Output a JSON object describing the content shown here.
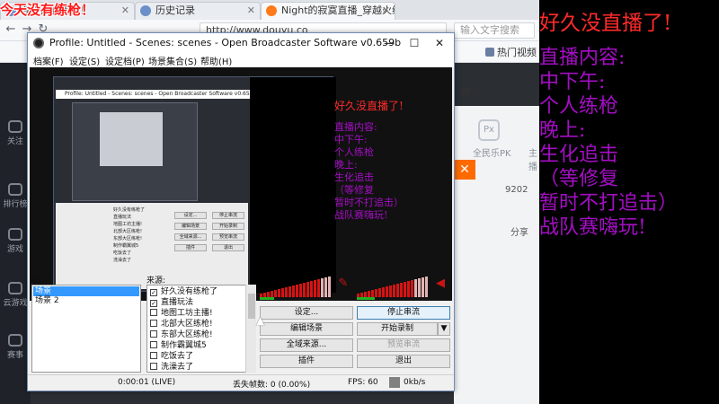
{
  "browser": {
    "tabs": [
      {
        "label": "今天没有练枪！",
        "active": false
      },
      {
        "label": "历史记录",
        "active": false
      },
      {
        "label": "Night的寂寞直播_穿越火线",
        "active": true
      }
    ],
    "url": "http://www.douyu.co",
    "search_hint": "输入文字搜索",
    "bookmarks": [
      {
        "label": "热门视频"
      }
    ],
    "douyu": {
      "sidebar": [
        "关注",
        "排行榜",
        "游戏",
        "云游戏",
        "赛事"
      ],
      "header_items": [
        "修",
        "Px"
      ],
      "pk_label": "全民乐PK",
      "view_count": "9202",
      "share": "分享",
      "side_label": "主播"
    }
  },
  "overlay": {
    "title": "好久没直播了!",
    "lines": [
      "直播内容:",
      "中下午:",
      "个人练枪",
      "晚上:",
      "生化追击",
      "（等修复",
      "暂时不打追击）",
      "战队赛嗨玩!"
    ]
  },
  "obs": {
    "title": "Profile: Untitled - Scenes: scenes - Open Broadcaster Software v0.659b",
    "window_controls": {
      "minimize": "—",
      "maximize": "☐",
      "close": "✕"
    },
    "menu": [
      "档案(F)",
      "设定(S)",
      "设定档(P)",
      "场景集合(S)",
      "帮助(H)"
    ],
    "preview_overlay_title": "好久没直播了!",
    "preview_overlay_lines": [
      "直播内容:",
      "中下午:",
      "个人练枪",
      "晚上:",
      "生化追击",
      "（等修复",
      "暂时不打追击）",
      "战队赛嗨玩!"
    ],
    "preview_title_text": "Profile: Untitled - Scenes: scenes - Open Broadcaster Software v0.659b",
    "scenes_label": "场景:",
    "scenes": [
      {
        "label": "场景",
        "selected": true
      },
      {
        "label": "场景 2",
        "selected": false
      }
    ],
    "sources_label": "来源:",
    "sources": [
      {
        "label": "好久没有练枪了",
        "checked": true
      },
      {
        "label": "直播玩法",
        "checked": true
      },
      {
        "label": "地图工坊主播!",
        "checked": false
      },
      {
        "label": "北部大区练枪!",
        "checked": false
      },
      {
        "label": "东部大区练枪!",
        "checked": false
      },
      {
        "label": "制作霸翼城5",
        "checked": false
      },
      {
        "label": "吃饭去了",
        "checked": false
      },
      {
        "label": "洗澡去了",
        "checked": false
      }
    ],
    "buttons": {
      "settings": "设定...",
      "stop_stream": "停止串流",
      "edit_scene": "编辑场景",
      "start_record": "开始录制",
      "global_sources": "全域来源...",
      "preview_stream": "预览串流",
      "plugins": "插件",
      "exit": "退出"
    },
    "status": {
      "time": "0:00:01 (LIVE)",
      "dropped_frames": "丢失帧数: 0 (0.00%)",
      "fps": "FPS: 60",
      "bitrate": "0kb/s"
    },
    "volume": {
      "desktop": 0.85,
      "mic": 0.8
    }
  },
  "stream_overlay_topleft": "今天没有练枪！",
  "colors": {
    "overlay_title": "#ff2a2a",
    "overlay_text": "#a40ec4",
    "obs_selected": "#3399ff",
    "meter": "#d41414",
    "orange": "#ff6a00"
  }
}
